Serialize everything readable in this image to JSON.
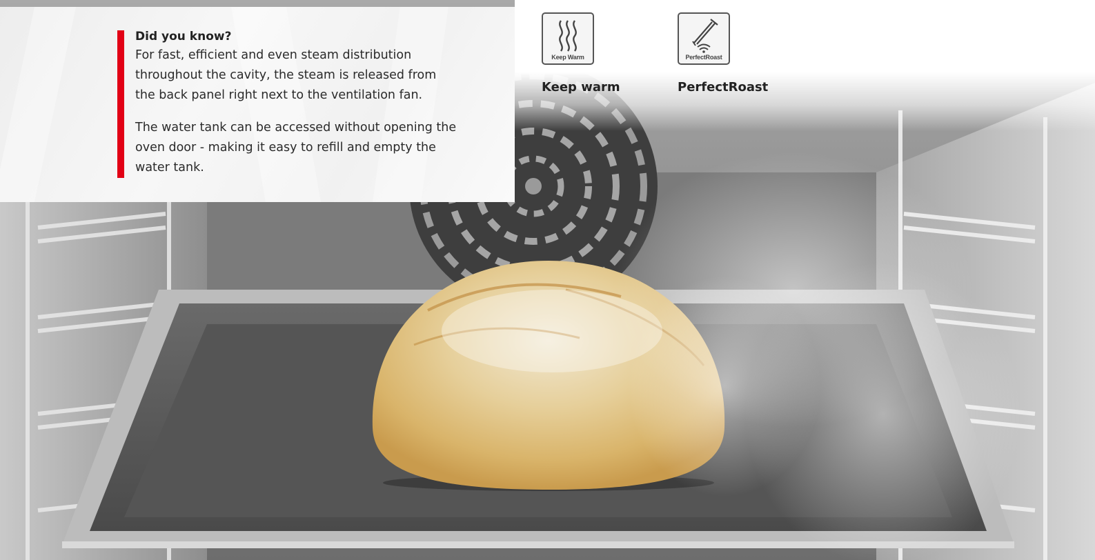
{
  "info": {
    "title": "Did you know?",
    "paragraph1": "For fast, efficient and even steam distribution throughout the cavity, the steam is released from the back panel right next to the ventilation fan.",
    "paragraph2": "The water tank can be accessed without opening the oven door - making it easy to refill and empty the water tank."
  },
  "features": [
    {
      "icon": "keep-warm-icon",
      "icon_text": "Keep Warm",
      "label": "Keep warm"
    },
    {
      "icon": "perfect-roast-icon",
      "icon_text": "PerfectRoast",
      "label": "PerfectRoast"
    }
  ],
  "colors": {
    "accent": "#e20015",
    "icon_border": "#555555",
    "panel_bg": "#f2f2f2"
  }
}
